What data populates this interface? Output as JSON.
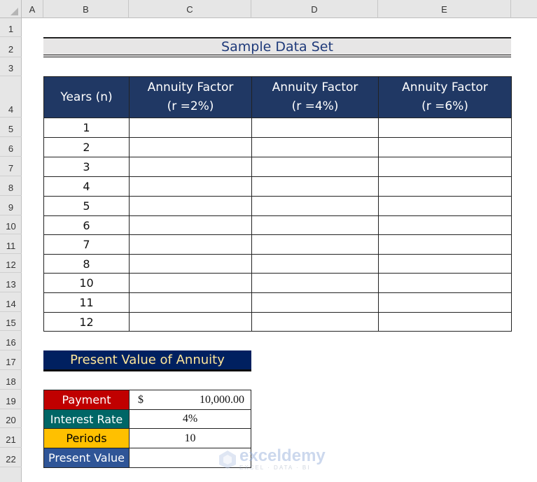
{
  "sheet": {
    "columns": [
      "A",
      "B",
      "C",
      "D",
      "E"
    ],
    "rows": [
      "1",
      "2",
      "3",
      "4",
      "5",
      "6",
      "7",
      "8",
      "9",
      "10",
      "11",
      "12",
      "13",
      "14",
      "15",
      "16",
      "17",
      "18",
      "19",
      "20",
      "21",
      "22"
    ]
  },
  "sample_title": "Sample Data Set",
  "table": {
    "headers": [
      {
        "line1": "Years (n)",
        "line2": ""
      },
      {
        "line1": "Annuity Factor",
        "line2": "(r =2%)"
      },
      {
        "line1": "Annuity Factor",
        "line2": "(r =4%)"
      },
      {
        "line1": "Annuity Factor",
        "line2": "(r =6%)"
      }
    ],
    "years": [
      "1",
      "2",
      "3",
      "4",
      "5",
      "6",
      "7",
      "8",
      "10",
      "11",
      "12"
    ]
  },
  "pv": {
    "title": "Present Value of Annuity",
    "rows": [
      {
        "label": "Payment",
        "currency": "$",
        "value": "10,000.00",
        "bg": "#C00000",
        "fg": "#FFFFFF"
      },
      {
        "label": "Interest Rate",
        "currency": "",
        "value": "4%",
        "bg": "#006666",
        "fg": "#FFFFFF"
      },
      {
        "label": "Periods",
        "currency": "",
        "value": "10",
        "bg": "#FFC000",
        "fg": "#000000"
      },
      {
        "label": "Present Value",
        "currency": "",
        "value": "",
        "bg": "#2F5597",
        "fg": "#FFFFFF"
      }
    ]
  },
  "watermark": {
    "main": "exceldemy",
    "sub": "EXCEL · DATA · BI"
  },
  "colors": {
    "header_navy": "#203864",
    "title_navy": "#002060",
    "title_text": "#FFE699"
  }
}
